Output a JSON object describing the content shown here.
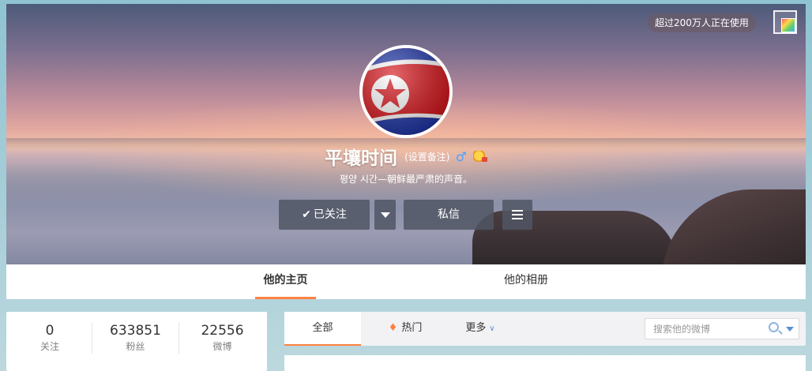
{
  "banner": {
    "users_pill": "超过200万人正在使用",
    "skin_icon": "skin-palette-icon"
  },
  "profile": {
    "name": "平壤时间",
    "remark_label": "(设置备注)",
    "gender_icon": "male-icon",
    "gender_symbol": "♂",
    "badge_icon": "vip-badge-icon",
    "bio": "평양 시간—朝鲜最严肃的声音。",
    "avatar": "north-korea-flag-avatar"
  },
  "actions": {
    "follow_label": "已关注",
    "follow_check": "✔",
    "message_label": "私信"
  },
  "tabs": [
    {
      "label": "他的主页",
      "active": true
    },
    {
      "label": "他的相册",
      "active": false
    }
  ],
  "stats": [
    {
      "value": "0",
      "label": "关注"
    },
    {
      "value": "633851",
      "label": "粉丝"
    },
    {
      "value": "22556",
      "label": "微博"
    }
  ],
  "feed": {
    "tabs": [
      {
        "label": "全部",
        "active": true
      },
      {
        "label": "热门",
        "icon": "flame-icon",
        "glyph": "🔥"
      },
      {
        "label": "更多",
        "icon": "chevron-down-icon",
        "glyph": "▼"
      }
    ],
    "search_placeholder": "搜索他的微博"
  },
  "colors": {
    "accent": "#ff8140",
    "link_blue": "#5b8fd6",
    "button_bg": "#505664"
  }
}
